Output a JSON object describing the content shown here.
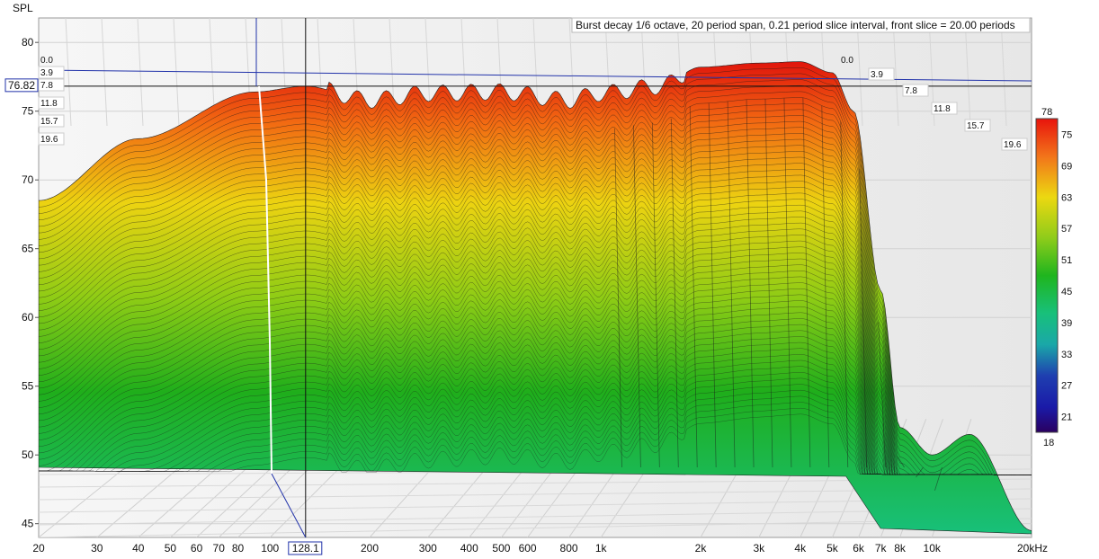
{
  "chart_data": {
    "type": "waterfall",
    "title": "Burst decay 1/6 octave, 20 period span, 0.21 period slice interval,  front slice = 20.00 periods",
    "ylabel": "SPL",
    "xlabel_suffix": "kHz",
    "ylim": [
      44,
      82
    ],
    "xlim": [
      20,
      20000
    ],
    "x_scale": "log",
    "y_ticks": [
      80,
      75,
      70,
      65,
      60,
      55,
      50,
      45
    ],
    "x_ticks": [
      {
        "value": 20,
        "label": "20"
      },
      {
        "value": 30,
        "label": "30"
      },
      {
        "value": 40,
        "label": "40"
      },
      {
        "value": 50,
        "label": "50"
      },
      {
        "value": 60,
        "label": "60"
      },
      {
        "value": 70,
        "label": "70"
      },
      {
        "value": 80,
        "label": "80"
      },
      {
        "value": 100,
        "label": "100"
      },
      {
        "value": 200,
        "label": "200"
      },
      {
        "value": 300,
        "label": "300"
      },
      {
        "value": 400,
        "label": "400"
      },
      {
        "value": 500,
        "label": "500"
      },
      {
        "value": 600,
        "label": "600"
      },
      {
        "value": 800,
        "label": "800"
      },
      {
        "value": 1000,
        "label": "1k"
      },
      {
        "value": 2000,
        "label": "2k"
      },
      {
        "value": 3000,
        "label": "3k"
      },
      {
        "value": 4000,
        "label": "4k"
      },
      {
        "value": 5000,
        "label": "5k"
      },
      {
        "value": 6000,
        "label": "6k"
      },
      {
        "value": 7000,
        "label": "7k"
      },
      {
        "value": 8000,
        "label": "8k"
      },
      {
        "value": 10000,
        "label": "10k"
      },
      {
        "value": 20000,
        "label": "20kHz"
      }
    ],
    "period_axis_left": [
      "0.0",
      "3.9",
      "7.8",
      "11.8",
      "15.7",
      "19.6"
    ],
    "period_axis_right": [
      "0.0",
      "3.9",
      "7.8",
      "11.8",
      "15.7",
      "19.6"
    ],
    "cursor": {
      "x": 128.1,
      "x_label": "128.1",
      "y": 76.82,
      "y_label": "76.82"
    },
    "colorbar": {
      "min": 18,
      "max": 78,
      "labels": [
        "78",
        "75",
        "69",
        "63",
        "57",
        "51",
        "45",
        "39",
        "33",
        "27",
        "21",
        "18"
      ]
    },
    "front_slice_spl": [
      {
        "hz": 20,
        "db": 68.5
      },
      {
        "hz": 40,
        "db": 73.0
      },
      {
        "hz": 90,
        "db": 76.4
      },
      {
        "hz": 128.1,
        "db": 76.82
      },
      {
        "hz": 200,
        "db": 75.8
      },
      {
        "hz": 300,
        "db": 76.3
      },
      {
        "hz": 500,
        "db": 76.4
      },
      {
        "hz": 800,
        "db": 75.8
      },
      {
        "hz": 1000,
        "db": 76.3
      },
      {
        "hz": 1500,
        "db": 76.8
      },
      {
        "hz": 2000,
        "db": 78.2
      },
      {
        "hz": 3000,
        "db": 78.5
      },
      {
        "hz": 4000,
        "db": 78.6
      },
      {
        "hz": 5000,
        "db": 77.8
      },
      {
        "hz": 5800,
        "db": 75.0
      },
      {
        "hz": 7000,
        "db": 62.0
      },
      {
        "hz": 8000,
        "db": 52.0
      },
      {
        "hz": 10000,
        "db": 50.0
      },
      {
        "hz": 13000,
        "db": 51.5
      },
      {
        "hz": 20000,
        "db": 44.5
      }
    ],
    "colors": {
      "hot": "#e81a0c",
      "warm": "#f07a12",
      "mid": "#e8dc10",
      "green": "#24b81f",
      "teal": "#19c27c",
      "axis_blue": "#2233aa",
      "background": "#efefef"
    }
  }
}
